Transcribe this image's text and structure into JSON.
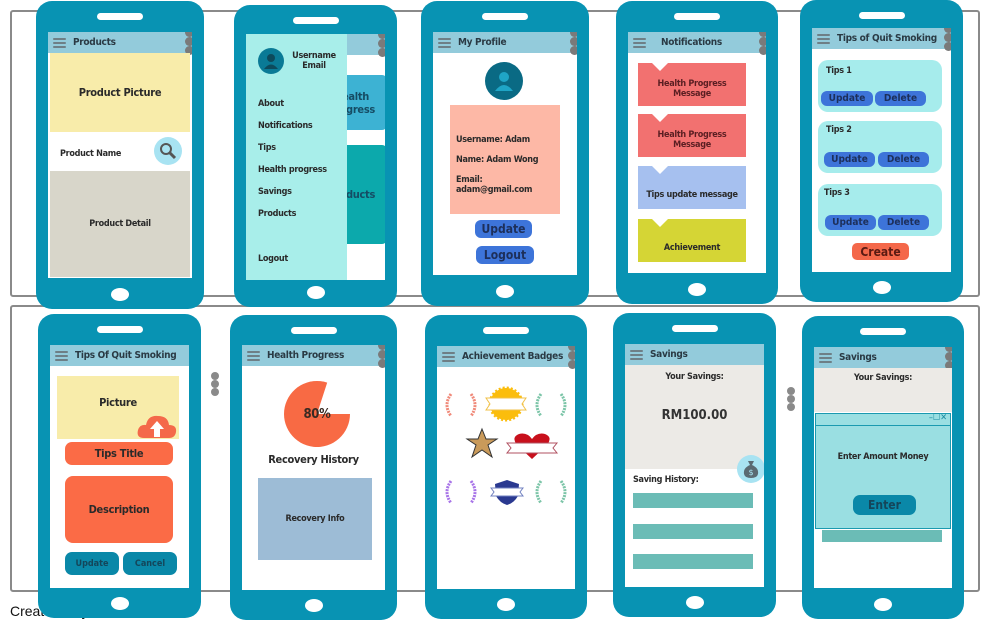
{
  "caption": "Create Storyboard",
  "colors": {
    "phone_body": "#0893b3",
    "topbar": "#93cbdb",
    "product_picture": "#f8ecaa",
    "product_detail": "#d8d6ca",
    "drawer": "#a8eeea",
    "profile_card": "#fdb8a6",
    "button_blue": "#3d74d9",
    "notif_health": "#f27170",
    "notif_tips": "#a6c0ef",
    "notif_achievement": "#d5d535",
    "tip_card": "#a6ecec",
    "create_button": "#f4684a",
    "tips_orange": "#fb6b46",
    "recovery_pie": "#f86a44",
    "recovery_info": "#9dbcd6",
    "savings_panel": "#eceae6",
    "history_bar": "#6bbcb6",
    "dialog": "#9adfe2"
  },
  "screens": {
    "products": {
      "title": "Products",
      "picture_label": "Product Picture",
      "name_label": "Product Name",
      "detail_label": "Product Detail",
      "search_icon": "search-icon"
    },
    "drawer": {
      "username": "Username",
      "email": "Email",
      "items": [
        "About",
        "Notifications",
        "Tips",
        "Health progress",
        "Savings",
        "Products"
      ],
      "logout": "Logout",
      "behind_card_1": "Health Progress",
      "behind_card_2": "Products"
    },
    "profile": {
      "title": "My Profile",
      "username_line": "Username: Adam",
      "name_line": "Name: Adam Wong",
      "email_line": "Email: adam@gmail.com",
      "update_label": "Update",
      "logout_label": "Logout"
    },
    "notifications": {
      "title": "Notifications",
      "items": [
        {
          "text": "Health Progress Message",
          "type": "health"
        },
        {
          "text": "Health Progress Message",
          "type": "health"
        },
        {
          "text": "Tips update message",
          "type": "tips"
        },
        {
          "text": "Achievement",
          "type": "achievement"
        }
      ]
    },
    "tips_list": {
      "title": "Tips of Quit Smoking",
      "tips": [
        {
          "label": "Tips 1",
          "update": "Update",
          "delete": "Delete"
        },
        {
          "label": "Tips 2",
          "update": "Update",
          "delete": "Delete"
        },
        {
          "label": "Tips 3",
          "update": "Update",
          "delete": "Delete"
        }
      ],
      "create_label": "Create"
    },
    "tips_edit": {
      "title": "Tips Of Quit Smoking",
      "picture_label": "Picture",
      "title_field": "Tips Title",
      "description_field": "Description",
      "update_label": "Update",
      "cancel_label": "Cancel"
    },
    "health": {
      "title": "Health Progress",
      "percent": 80,
      "percent_label": "80%",
      "history_label": "Recovery History",
      "info_label": "Recovery Info"
    },
    "badges": {
      "title": "Achievement Badges",
      "items": [
        "laurel-red-badge",
        "gold-seal-ribbon-badge",
        "laurel-green-badge",
        "sheriff-star-badge",
        "heart-ribbon-badge",
        "laurel-purple-badge",
        "shield-ribbon-badge",
        "laurel-teal-badge"
      ]
    },
    "savings": {
      "title": "Savings",
      "your_savings_label": "Your Savings:",
      "amount": "RM100.00",
      "history_label": "Saving History:",
      "history_rows": 3
    },
    "savings_dialog": {
      "title": "Savings",
      "your_savings_label": "Your Savings:",
      "window_controls": "–☐✕",
      "prompt": "Enter Amount Money",
      "enter_label": "Enter"
    }
  }
}
